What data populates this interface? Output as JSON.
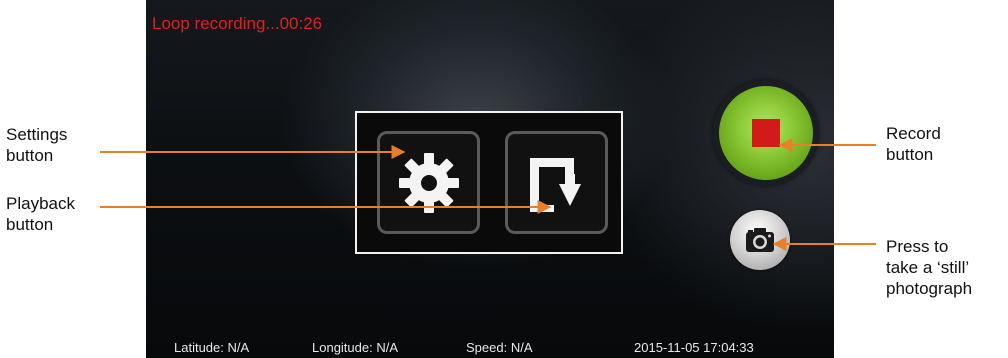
{
  "screen": {
    "recording_status": "Loop recording...00:26",
    "status_bar": {
      "latitude": "Latitude: N/A",
      "longitude": "Longitude: N/A",
      "speed": "Speed: N/A",
      "datetime": "2015-11-05  17:04:33"
    },
    "icons": {
      "settings": "gear-icon",
      "playback": "playback-icon",
      "record": "stop-square-icon",
      "camera": "camera-icon"
    },
    "colors": {
      "recording_text": "#e02020",
      "record_button": "#8fcc3a",
      "stop_square": "#d21a1a",
      "callout_arrow": "#e8802a"
    }
  },
  "callouts": {
    "settings": [
      "Settings",
      "button"
    ],
    "playback": [
      "Playback",
      "button"
    ],
    "record": [
      "Record",
      "button"
    ],
    "still": [
      "Press to",
      "take a ‘still’",
      "photograph"
    ]
  }
}
